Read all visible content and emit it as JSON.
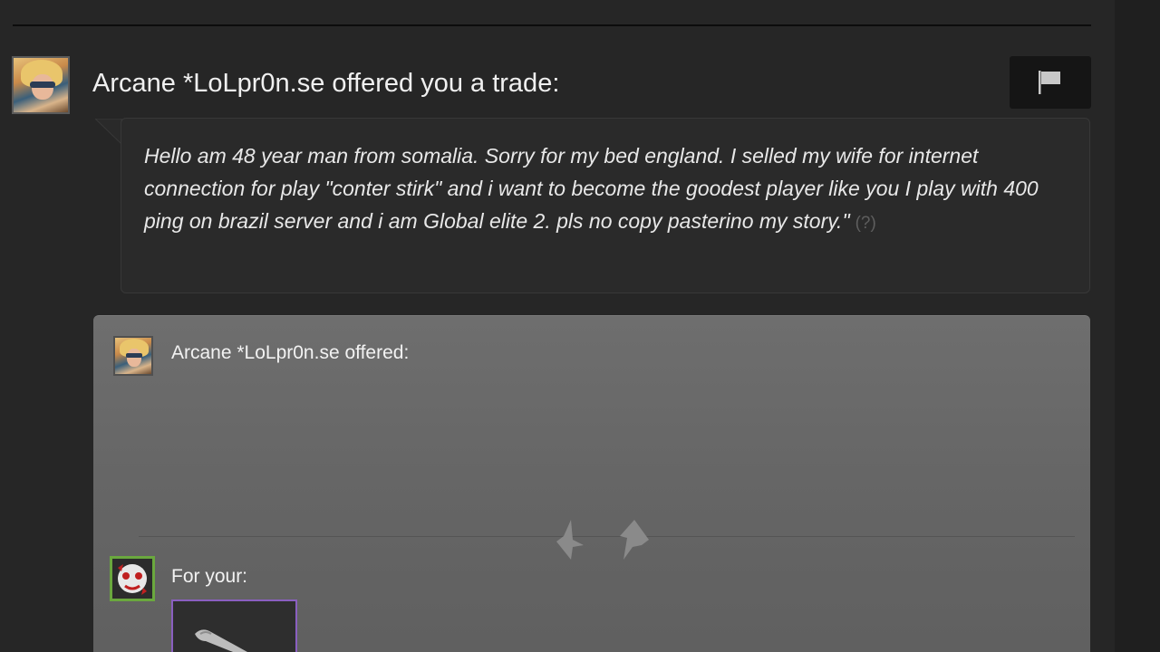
{
  "header": {
    "title": "Arcane *LoLpr0n.se offered you a trade:",
    "flag_icon": "flag-icon"
  },
  "message": {
    "text": "Hello am 48 year man from somalia. Sorry for my bed england. I selled my wife for internet connection for play \"conter stirk\" and i want to become the goodest player like you I play with 400 ping on brazil server and i am Global elite 2. pls no copy pasterino my story.\"",
    "help_label": "(?)"
  },
  "trade": {
    "offered_label": "Arcane *LoLpr0n.se offered:",
    "for_your_label": "For your:",
    "swap_icon": "swap-arrows-icon",
    "item_icon": "knife-item-icon",
    "colors": {
      "panel": "#676767",
      "item_border": "#8a5fc0",
      "avatar_border_green": "#6aa83e"
    }
  }
}
